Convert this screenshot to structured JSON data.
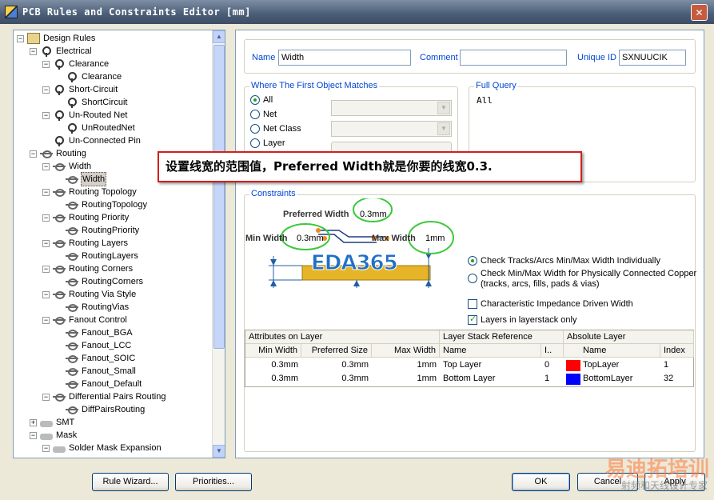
{
  "window": {
    "title": "PCB Rules and Constraints Editor [mm]"
  },
  "tree": {
    "items": [
      {
        "label": "Design Rules",
        "level": 0,
        "expander": "-",
        "icon": "design-rules-folder-icon"
      },
      {
        "label": "Electrical",
        "level": 1,
        "expander": "-",
        "icon": "rule-class-icon"
      },
      {
        "label": "Clearance",
        "level": 2,
        "expander": "-",
        "icon": "rule-class-icon"
      },
      {
        "label": "Clearance",
        "level": 3,
        "expander": "",
        "icon": "rule-icon"
      },
      {
        "label": "Short-Circuit",
        "level": 2,
        "expander": "-",
        "icon": "rule-class-icon"
      },
      {
        "label": "ShortCircuit",
        "level": 3,
        "expander": "",
        "icon": "rule-icon"
      },
      {
        "label": "Un-Routed Net",
        "level": 2,
        "expander": "-",
        "icon": "rule-class-icon"
      },
      {
        "label": "UnRoutedNet",
        "level": 3,
        "expander": "",
        "icon": "rule-icon"
      },
      {
        "label": "Un-Connected Pin",
        "level": 2,
        "expander": "",
        "icon": "rule-class-icon"
      },
      {
        "label": "Routing",
        "level": 1,
        "expander": "-",
        "icon": "routing-icon"
      },
      {
        "label": "Width",
        "level": 2,
        "expander": "-",
        "icon": "routing-icon"
      },
      {
        "label": "Width",
        "level": 3,
        "expander": "",
        "icon": "routing-icon",
        "selected": true
      },
      {
        "label": "Routing Topology",
        "level": 2,
        "expander": "-",
        "icon": "routing-icon"
      },
      {
        "label": "RoutingTopology",
        "level": 3,
        "expander": "",
        "icon": "routing-icon"
      },
      {
        "label": "Routing Priority",
        "level": 2,
        "expander": "-",
        "icon": "routing-icon"
      },
      {
        "label": "RoutingPriority",
        "level": 3,
        "expander": "",
        "icon": "routing-icon"
      },
      {
        "label": "Routing Layers",
        "level": 2,
        "expander": "-",
        "icon": "routing-icon"
      },
      {
        "label": "RoutingLayers",
        "level": 3,
        "expander": "",
        "icon": "routing-icon"
      },
      {
        "label": "Routing Corners",
        "level": 2,
        "expander": "-",
        "icon": "routing-icon"
      },
      {
        "label": "RoutingCorners",
        "level": 3,
        "expander": "",
        "icon": "routing-icon"
      },
      {
        "label": "Routing Via Style",
        "level": 2,
        "expander": "-",
        "icon": "routing-icon"
      },
      {
        "label": "RoutingVias",
        "level": 3,
        "expander": "",
        "icon": "routing-icon"
      },
      {
        "label": "Fanout Control",
        "level": 2,
        "expander": "-",
        "icon": "routing-icon"
      },
      {
        "label": "Fanout_BGA",
        "level": 3,
        "expander": "",
        "icon": "routing-icon"
      },
      {
        "label": "Fanout_LCC",
        "level": 3,
        "expander": "",
        "icon": "routing-icon"
      },
      {
        "label": "Fanout_SOIC",
        "level": 3,
        "expander": "",
        "icon": "routing-icon"
      },
      {
        "label": "Fanout_Small",
        "level": 3,
        "expander": "",
        "icon": "routing-icon"
      },
      {
        "label": "Fanout_Default",
        "level": 3,
        "expander": "",
        "icon": "routing-icon"
      },
      {
        "label": "Differential Pairs Routing",
        "level": 2,
        "expander": "-",
        "icon": "routing-icon"
      },
      {
        "label": "DiffPairsRouting",
        "level": 3,
        "expander": "",
        "icon": "routing-icon"
      },
      {
        "label": "SMT",
        "level": 1,
        "expander": "+",
        "icon": "smt-icon"
      },
      {
        "label": "Mask",
        "level": 1,
        "expander": "-",
        "icon": "mask-icon"
      },
      {
        "label": "Solder Mask Expansion",
        "level": 2,
        "expander": "-",
        "icon": "mask-icon"
      }
    ]
  },
  "rule": {
    "name_label": "Name",
    "name_value": "Width",
    "comment_label": "Comment",
    "comment_value": "",
    "unique_id_label": "Unique ID",
    "unique_id_value": "SXNUUCIK"
  },
  "first_object": {
    "title": "Where The First Object Matches",
    "options": [
      {
        "label": "All",
        "checked": true
      },
      {
        "label": "Net",
        "checked": false
      },
      {
        "label": "Net Class",
        "checked": false
      },
      {
        "label": "Layer",
        "checked": false
      }
    ]
  },
  "full_query": {
    "title": "Full Query",
    "text": "All"
  },
  "callout": {
    "text": "设置线宽的范围值，Preferred  Width就是你要的线宽0.3."
  },
  "constraints": {
    "title": "Constraints",
    "preferred_width_label": "Preferred Width",
    "preferred_width_value": "0.3mm",
    "min_width_label": "Min Width",
    "min_width_value": "0.3mm",
    "max_width_label": "Max Width",
    "max_width_value": "1mm",
    "logo_text": "EDA365",
    "options": [
      {
        "label": "Check Tracks/Arcs Min/Max Width Individually",
        "checked": true
      },
      {
        "label": "Check Min/Max Width for Physically Connected Copper",
        "sub": "(tracks, arcs, fills, pads & vias)",
        "checked": false
      }
    ],
    "impedance_label": "Characteristic Impedance Driven Width",
    "impedance_checked": false,
    "layerstack_label": "Layers in layerstack only",
    "layerstack_checked": true
  },
  "grid": {
    "group_headers": [
      "Attributes on Layer",
      "Layer Stack Reference",
      "Absolute Layer"
    ],
    "columns": [
      "Min Width",
      "Preferred Size",
      "Max Width",
      "Name",
      "I..",
      "Name",
      "Index"
    ],
    "rows": [
      {
        "min": "0.3mm",
        "pref": "0.3mm",
        "max": "1mm",
        "stack_name": "Top Layer",
        "stack_index": "0",
        "color": "#ff0000",
        "abs_name": "TopLayer",
        "abs_index": "1"
      },
      {
        "min": "0.3mm",
        "pref": "0.3mm",
        "max": "1mm",
        "stack_name": "Bottom Layer",
        "stack_index": "1",
        "color": "#0000ff",
        "abs_name": "BottomLayer",
        "abs_index": "32"
      }
    ]
  },
  "buttons": {
    "rule_wizard": "Rule Wizard...",
    "priorities": "Priorities...",
    "ok": "OK",
    "cancel": "Cancel",
    "apply": "Apply"
  },
  "watermark": {
    "main": "易迪拓培训",
    "sub": "射频和天线设计专家"
  }
}
